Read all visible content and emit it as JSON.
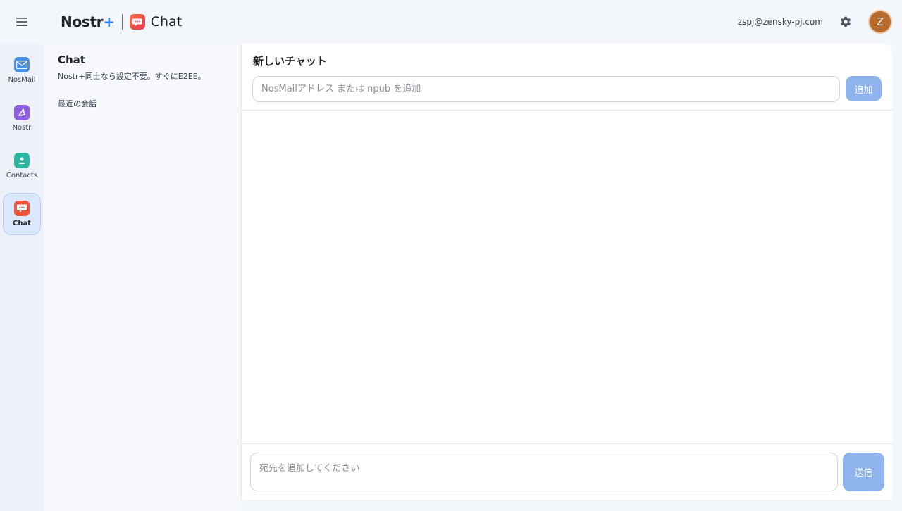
{
  "header": {
    "menu_icon": "hamburger-menu-icon",
    "brand_name": "Nostr",
    "brand_plus": "+",
    "app_name": "Chat",
    "app_icon": "chat-bubble-icon",
    "user_email": "zspj@zensky-pj.com",
    "settings_icon": "gear-icon",
    "avatar_initial": "Z"
  },
  "rail": {
    "items": [
      {
        "label": "NosMail",
        "icon": "mail-icon",
        "color": "#4a90e2",
        "active": false
      },
      {
        "label": "Nostr",
        "icon": "nostr-icon",
        "color": "#8e5ee0",
        "active": false
      },
      {
        "label": "Contacts",
        "icon": "contact-icon",
        "color": "#2cb5a0",
        "active": false
      },
      {
        "label": "Chat",
        "icon": "chat-bubble-icon",
        "color": "#f0543b",
        "active": true
      }
    ]
  },
  "list_panel": {
    "title": "Chat",
    "subtitle": "Nostr+同士なら設定不要。すぐにE2EE。",
    "section_title": "最近の会話"
  },
  "main": {
    "title": "新しいチャット",
    "recipient_placeholder": "NosMailアドレス または npub を追加",
    "add_label": "追加",
    "composer_placeholder": "宛先を追加してください",
    "send_label": "送信"
  },
  "colors": {
    "accent": "#2f80ed",
    "button_disabled": "#8fb3ec",
    "avatar": "#b76a2a"
  }
}
